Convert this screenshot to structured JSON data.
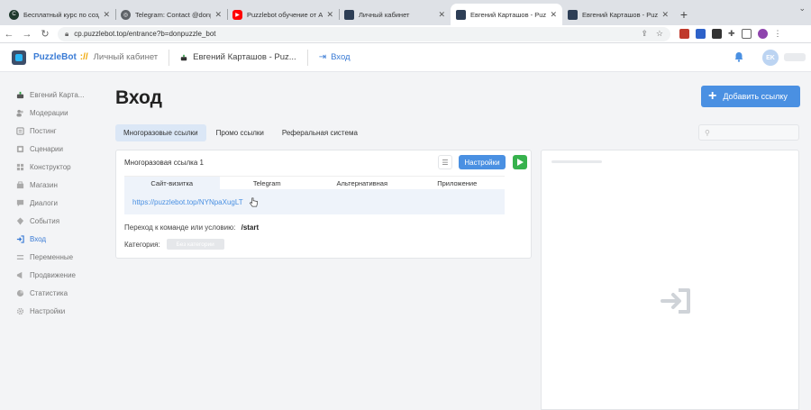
{
  "browser": {
    "tabs": [
      {
        "title": "Бесплатный курс по созданию",
        "favicon_color": "#1f3a2d",
        "active": false
      },
      {
        "title": "Telegram: Contact @donpuzzle",
        "favicon_color": "#5f6368",
        "active": false
      },
      {
        "title": "Puzzlebot обучение от А до Я",
        "favicon_color": "#ff0000",
        "active": false
      },
      {
        "title": "Личный кабинет",
        "favicon_color": "#2d3e56",
        "active": false
      },
      {
        "title": "Евгений Карташов - Puzzlebot",
        "favicon_color": "#2d3e56",
        "active": true
      },
      {
        "title": "Евгений Карташов - Puzzlebot",
        "favicon_color": "#2d3e56",
        "active": false
      }
    ],
    "url": "cp.puzzlebot.top/entrance?b=donpuzzle_bot"
  },
  "header": {
    "brand": "PuzzleBot",
    "brand_sep": "://",
    "brand_sub": "Личный кабинет",
    "bot_name": "Евгений Карташов - Puz...",
    "current_page": "Вход",
    "avatar_initials": "EK"
  },
  "sidebar": {
    "items": [
      {
        "label": "Евгений Карта...",
        "icon": "bot-icon",
        "active": false
      },
      {
        "label": "Модерации",
        "icon": "users-icon",
        "active": false
      },
      {
        "label": "Постинг",
        "icon": "posting-icon",
        "active": false
      },
      {
        "label": "Сценарии",
        "icon": "scenario-icon",
        "active": false
      },
      {
        "label": "Конструктор",
        "icon": "constructor-icon",
        "active": false
      },
      {
        "label": "Магазин",
        "icon": "shop-icon",
        "active": false
      },
      {
        "label": "Диалоги",
        "icon": "dialogs-icon",
        "active": false
      },
      {
        "label": "События",
        "icon": "events-icon",
        "active": false
      },
      {
        "label": "Вход",
        "icon": "entrance-icon",
        "active": true
      },
      {
        "label": "Переменные",
        "icon": "variables-icon",
        "active": false
      },
      {
        "label": "Продвижение",
        "icon": "promo-icon",
        "active": false
      },
      {
        "label": "Статистика",
        "icon": "stats-icon",
        "active": false
      },
      {
        "label": "Настройки",
        "icon": "settings-icon",
        "active": false
      }
    ]
  },
  "main": {
    "title": "Вход",
    "add_button": "Добавить ссылку",
    "tabs": [
      "Многоразовые ссылки",
      "Промо ссылки",
      "Реферальная система"
    ],
    "card": {
      "title": "Многоразовая ссылка 1",
      "settings_button": "Настройки",
      "inner_tabs": [
        "Сайт-визитка",
        "Telegram",
        "Альтернативная",
        "Приложение"
      ],
      "link": "https://puzzlebot.top/NYNpaXugLT",
      "command_label": "Переход к команде или условию:",
      "command_value": "/start",
      "category_label": "Категория:",
      "category_value": "Без категории"
    }
  },
  "colors": {
    "accent": "#4a90e2",
    "play": "#37b24d"
  }
}
